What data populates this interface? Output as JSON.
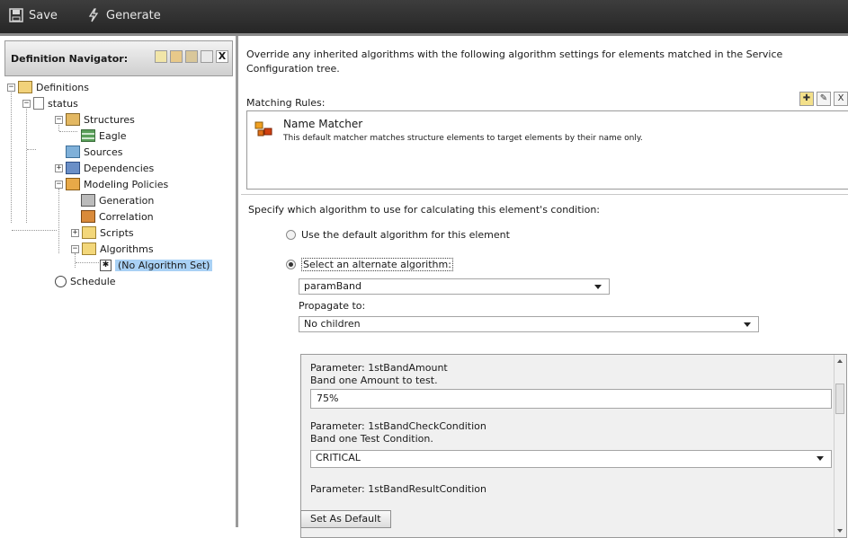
{
  "toolbar": {
    "save_label": "Save",
    "generate_label": "Generate"
  },
  "navigator": {
    "title": "Definition Navigator:",
    "tree": {
      "definitions": "Definitions",
      "status": "status",
      "structures": "Structures",
      "eagle": "Eagle",
      "sources": "Sources",
      "dependencies": "Dependencies",
      "modeling_policies": "Modeling Policies",
      "generation": "Generation",
      "correlation": "Correlation",
      "scripts": "Scripts",
      "algorithms": "Algorithms",
      "no_algorithm": "(No Algorithm Set)",
      "schedule": "Schedule"
    }
  },
  "main": {
    "description": "Override any inherited algorithms with the following algorithm settings for elements matched in the Service Configuration tree.",
    "matching_rules_label": "Matching Rules:",
    "matcher": {
      "name": "Name Matcher",
      "desc": "This default matcher matches structure elements to target elements by their name only."
    },
    "specify_label": "Specify which algorithm to use for calculating this element's condition:",
    "radio_default": "Use the default algorithm for this element",
    "radio_alternate": "Select an alternate algorithm:",
    "algorithm_value": "paramBand",
    "propagate_label": "Propagate to:",
    "propagate_value": "No children",
    "params": {
      "p1_name": "Parameter: 1stBandAmount",
      "p1_desc": "Band one Amount to test.",
      "p1_value": "75%",
      "p2_name": "Parameter: 1stBandCheckCondition",
      "p2_desc": "Band one Test Condition.",
      "p2_value": "CRITICAL",
      "p3_name": "Parameter: 1stBandResultCondition"
    },
    "set_default_label": "Set As Default"
  }
}
